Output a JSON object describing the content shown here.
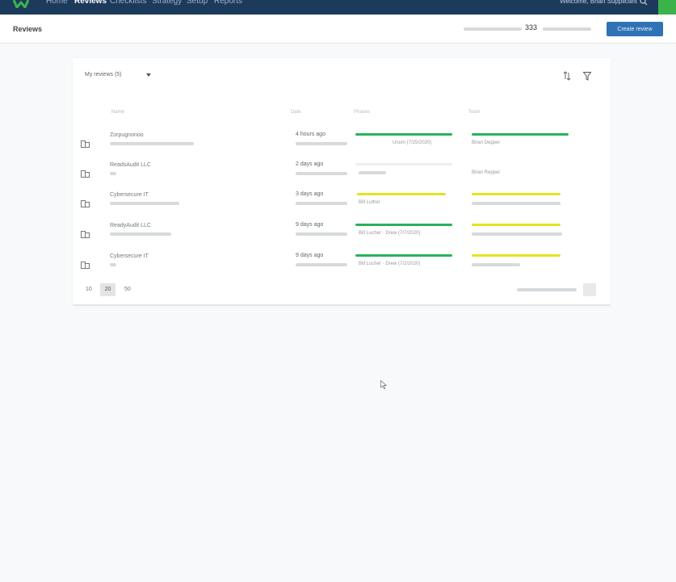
{
  "topnav": {
    "items": [
      "Home",
      "Reviews",
      "Checklists",
      "Strategy",
      "Setup",
      "Reports"
    ],
    "active": "Reviews",
    "welcome": "Welcome, Brian Supplicant"
  },
  "page": {
    "title": "Reviews",
    "stat_value": "333",
    "create_button": "Create review"
  },
  "toolbar": {
    "filter_value": "My reviews (5)"
  },
  "table": {
    "columns": [
      "Name",
      "Date",
      "Phases",
      "Team"
    ],
    "rows": [
      {
        "name": "Zorpugnonoo",
        "date": "4 hours ago",
        "phase1": "green",
        "phase2": "green",
        "phase_text": "Unum (7/25/2020)",
        "team_text": "Brian Deppel"
      },
      {
        "name": "ReadsAudit LLC",
        "date": "2 days ago",
        "phase1": "",
        "phase2": "",
        "phase_text": "",
        "team_text": "Brian Reppel"
      },
      {
        "name": "Cybersecure IT",
        "date": "3 days ago",
        "phase1": "yellow",
        "phase2": "yellow",
        "phase_text": "Bill Luther",
        "team_text": ""
      },
      {
        "name": "ReadyAudit LLC",
        "date": "9 days ago",
        "phase1": "green",
        "phase2": "yellow",
        "phase_text": "Bill Lucher · Drew (7/7/2020)",
        "team_text": ""
      },
      {
        "name": "Cybersecure IT",
        "date": "9 days ago",
        "phase1": "green",
        "phase2": "yellow",
        "phase_text": "Bill Lucher · Drew (7/2/2020)",
        "team_text": ""
      }
    ]
  },
  "pagination": {
    "sizes": [
      "10",
      "20",
      "50"
    ],
    "selected": "20"
  },
  "colors": {
    "nav_bg": "#1c3a5c",
    "accent": "#2f73b6",
    "status_green": "#27b35a",
    "status_yellow": "#e3e422"
  }
}
